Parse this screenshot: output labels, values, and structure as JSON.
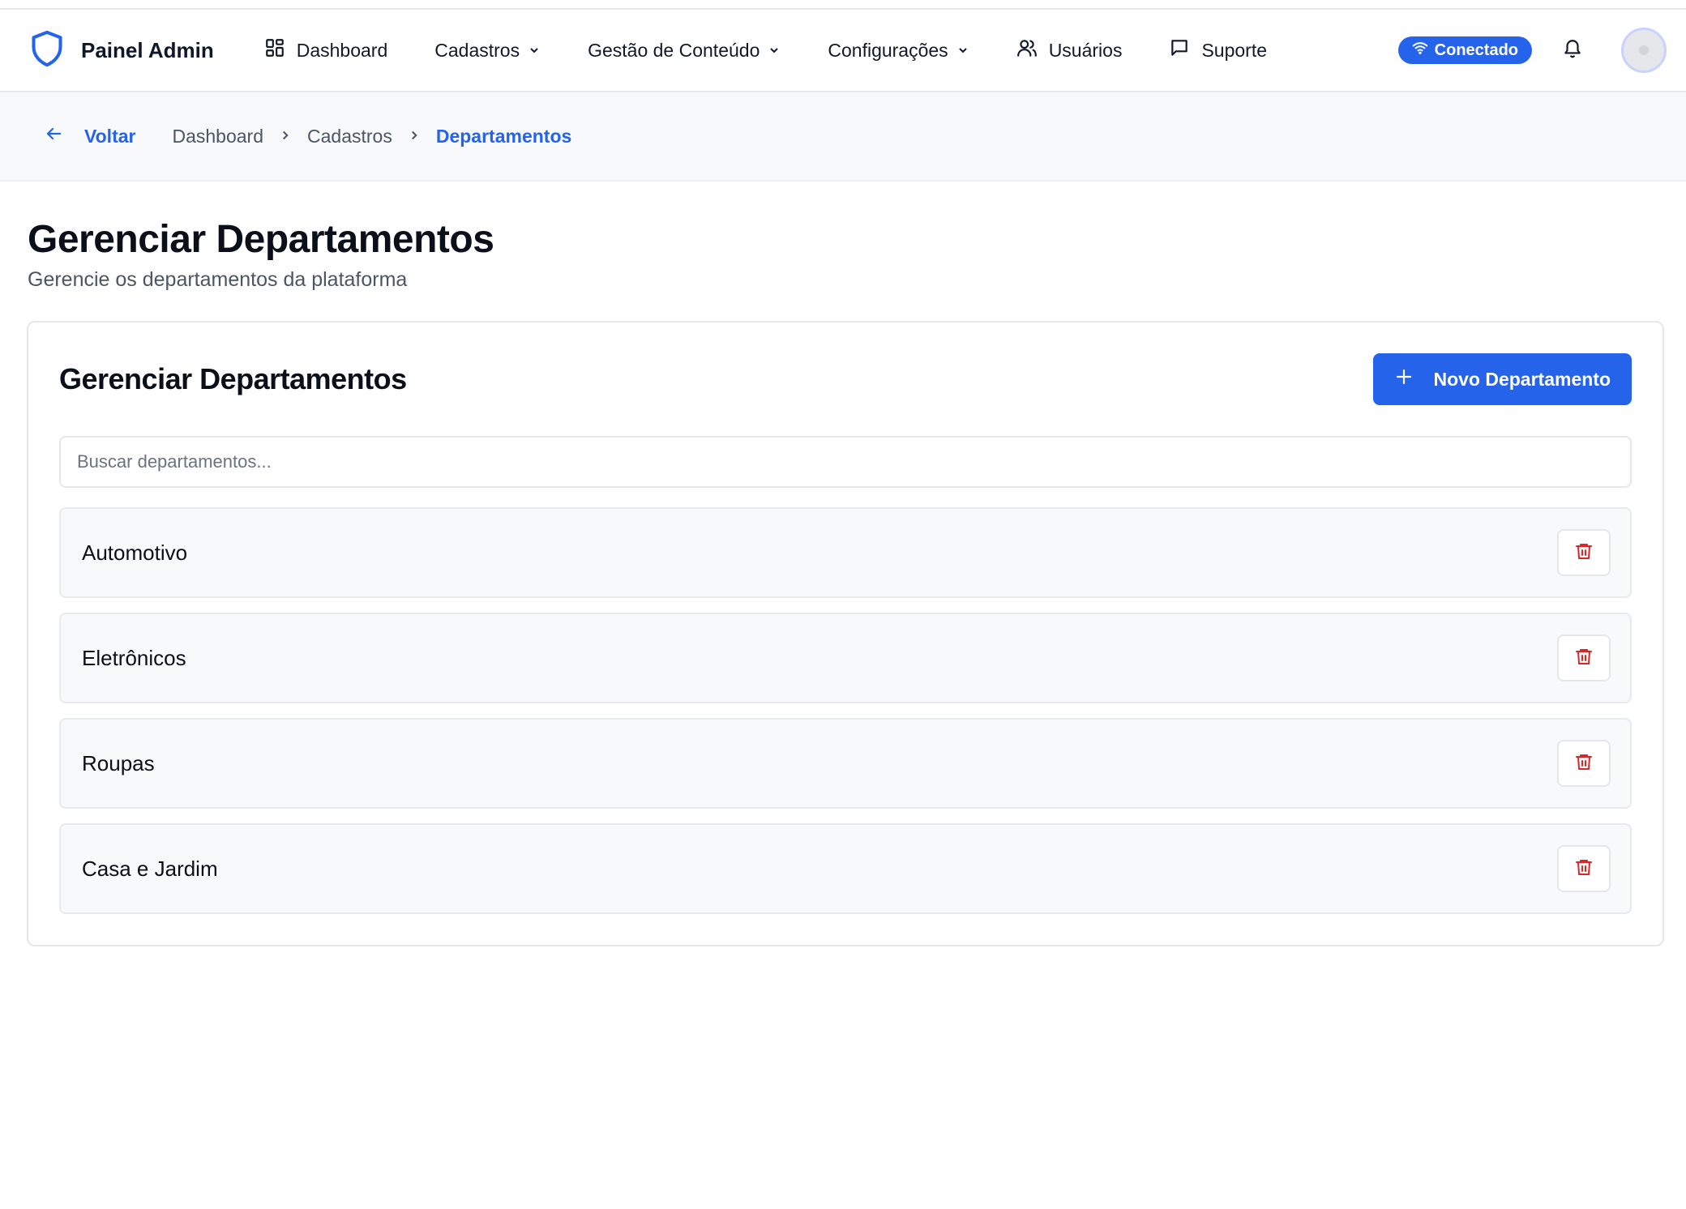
{
  "header": {
    "brand_name": "Painel Admin",
    "nav": [
      {
        "label": "Dashboard",
        "icon": "grid-icon"
      },
      {
        "label": "Cadastros",
        "has_dropdown": true
      },
      {
        "label": "Gestão de Conteúdo",
        "has_dropdown": true
      },
      {
        "label": "Configurações",
        "has_dropdown": true
      },
      {
        "label": "Usuários",
        "icon": "users-icon"
      },
      {
        "label": "Suporte",
        "icon": "message-icon"
      }
    ],
    "status_label": "Conectado",
    "accent_color": "#2563eb"
  },
  "breadcrumb": {
    "back_label": "Voltar",
    "items": [
      "Dashboard",
      "Cadastros",
      "Departamentos"
    ]
  },
  "page": {
    "title": "Gerenciar Departamentos",
    "subtitle": "Gerencie os departamentos da plataforma"
  },
  "card": {
    "title": "Gerenciar Departamentos",
    "new_button_label": "Novo Departamento",
    "search_placeholder": "Buscar departamentos...",
    "search_value": "",
    "departments": [
      {
        "name": "Automotivo"
      },
      {
        "name": "Eletrônicos"
      },
      {
        "name": "Roupas"
      },
      {
        "name": "Casa e Jardim"
      }
    ],
    "delete_color": "#dc2626"
  }
}
